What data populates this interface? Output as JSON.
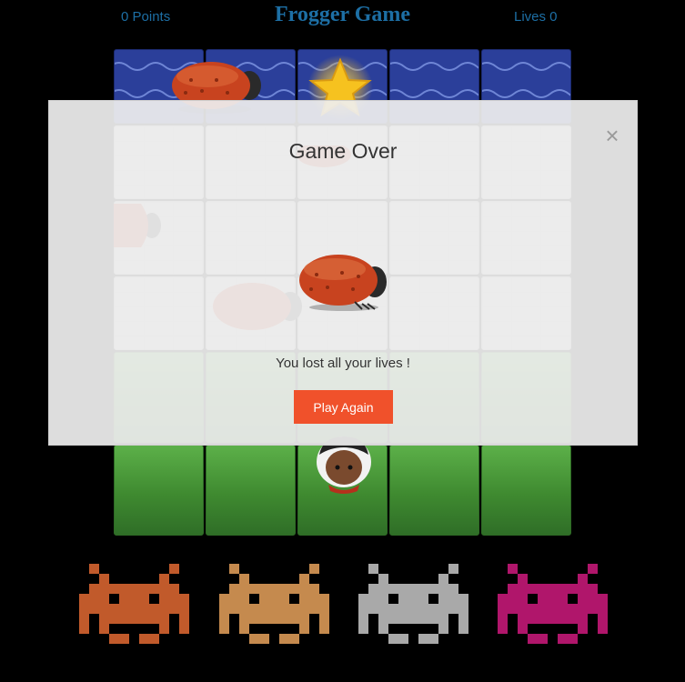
{
  "hud": {
    "points": "0 Points",
    "title": "Frogger Game",
    "lives": "Lives 0"
  },
  "board": {
    "columns": 5,
    "rows": [
      "water",
      "stone",
      "stone",
      "stone",
      "grass",
      "grass"
    ]
  },
  "modal": {
    "title": "Game Over",
    "message": "You lost all your lives !",
    "button_label": "Play Again",
    "close_label": "×"
  },
  "colors": {
    "hud_text": "#1d6fa5",
    "button": "#f0512b",
    "invaders": [
      "#c15a2b",
      "#c58a4e",
      "#a9a9a9",
      "#b0166b"
    ]
  },
  "icons": {
    "enemy": "ladybug-icon",
    "collectible": "star-icon",
    "player": "boy-character-icon",
    "decor": "space-invader-icon"
  }
}
